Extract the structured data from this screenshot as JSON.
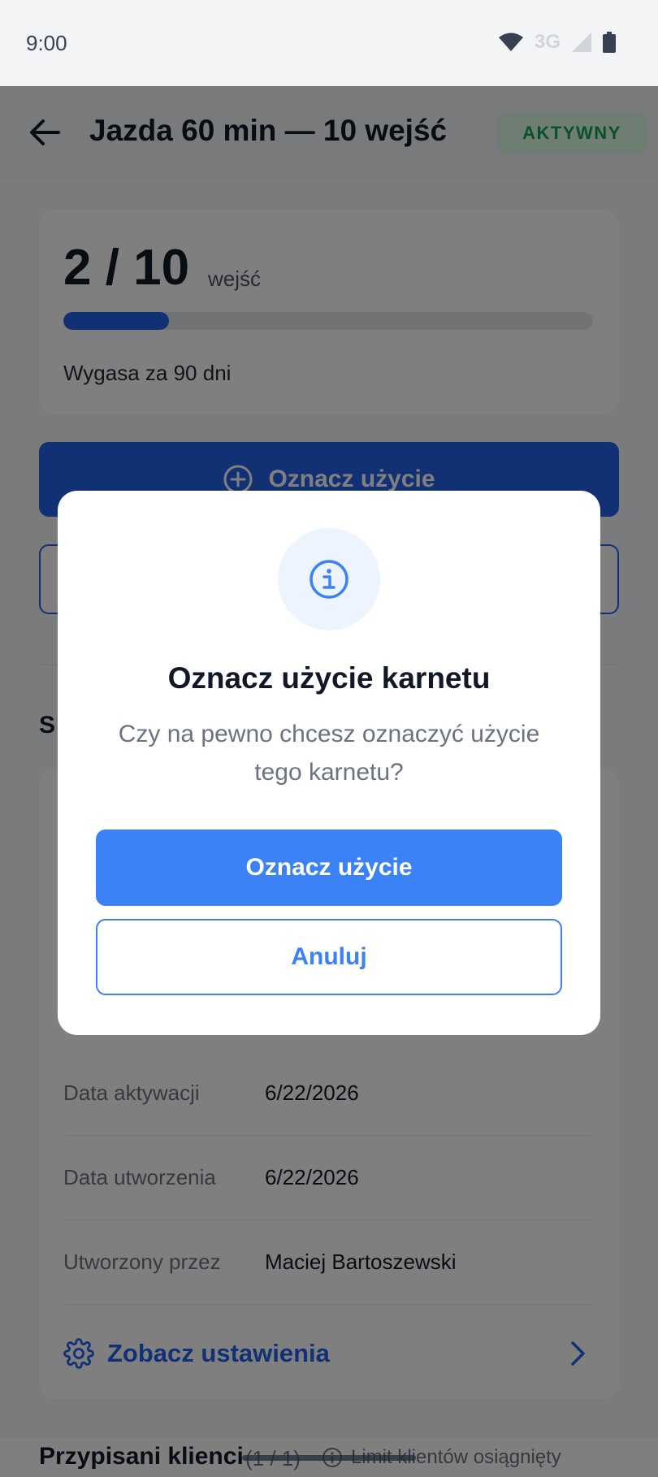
{
  "status_bar": {
    "time": "9:00",
    "network": "3G"
  },
  "header": {
    "title": "Jazda 60 min — 10 wejść",
    "badge": "AKTYWNY"
  },
  "usage": {
    "count": "2 / 10",
    "unit": "wejść",
    "progress": 0.2,
    "expiry": "Wygasa za 90 dni"
  },
  "actions": {
    "mark_use_label": "Oznacz użycie"
  },
  "details": {
    "section_title_fragment": "S",
    "rows": [
      {
        "label": "Data aktywacji",
        "value": "6/22/2026"
      },
      {
        "label": "Data utworzenia",
        "value": "6/22/2026"
      },
      {
        "label": "Utworzony przez",
        "value": "Maciej Bartoszewski"
      }
    ],
    "settings_link": "Zobacz ustawienia"
  },
  "footer": {
    "title": "Przypisani klienci",
    "count": "(1 / 1)",
    "limit_text": "Limit klientów osiągnięty"
  },
  "dialog": {
    "title": "Oznacz użycie karnetu",
    "message": "Czy na pewno chcesz oznaczyć użycie tego karnetu?",
    "confirm_label": "Oznacz użycie",
    "cancel_label": "Anuluj"
  },
  "colors": {
    "primary": "#2563eb",
    "dialog_primary": "#3b82f6",
    "active_badge_bg": "#dcfce7",
    "active_badge_text": "#16a34a"
  }
}
